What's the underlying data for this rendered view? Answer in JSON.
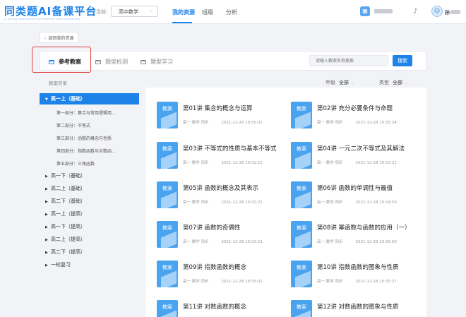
{
  "header": {
    "logo": "同类题AI备课平台",
    "logo_sub": "AI LESSON PREPARATION PLATFORM FOR SIMILAR PROBLEMS",
    "grade_label": "当前:",
    "grade_value": "高中数学",
    "nav": [
      "我的资源",
      "班级",
      "分析"
    ],
    "user_name": "孙"
  },
  "back_label": "返回我的资源",
  "tabs": [
    "参考教案",
    "题型检测",
    "题型学习"
  ],
  "search": {
    "placeholder": "请输入教案名称搜索",
    "button": "搜索"
  },
  "sidebar": {
    "title": "教案目录",
    "groups": [
      {
        "label": "高一上（基础）",
        "expanded": true,
        "children": [
          "第一部分：集合与常用逻辑用...",
          "第二部分：不等式",
          "第三部分：函数的概念与性质",
          "第四部分：指数函数与对数函...",
          "第五部分：三角函数"
        ]
      },
      {
        "label": "高一下（基础）"
      },
      {
        "label": "高二上（基础）"
      },
      {
        "label": "高二下（基础）"
      },
      {
        "label": "高一上（提高）"
      },
      {
        "label": "高一下（提高）"
      },
      {
        "label": "高二上（提高）"
      },
      {
        "label": "高二下（提高）"
      },
      {
        "label": "一轮复习"
      }
    ]
  },
  "filters": {
    "grade": {
      "label": "年级",
      "value": "全部"
    },
    "type": {
      "label": "类型",
      "value": "全部"
    }
  },
  "card_common": {
    "thumb_label": "教案",
    "meta": "高一 数学 同步"
  },
  "cards": [
    {
      "title": "第01讲 集合的概念与运算",
      "date": "2021-12-28 10:05:01"
    },
    {
      "title": "第02讲 充分必要条件与命题",
      "date": "2021-12-28 10:05:24"
    },
    {
      "title": "第03讲 不等式的性质与基本不等式",
      "date": "2021-12-28 10:02:21"
    },
    {
      "title": "第04讲 一元二次不等式及其解法",
      "date": "2021-12-28 10:02:21"
    },
    {
      "title": "第05讲 函数的概念及其表示",
      "date": "2021-12-28 10:02:21"
    },
    {
      "title": "第06讲 函数的单调性与最值",
      "date": "2021-12-28 10:04:59"
    },
    {
      "title": "第07讲 函数的奇偶性",
      "date": "2021-12-28 10:02:21"
    },
    {
      "title": "第08讲 幂函数与函数的应用（一）",
      "date": "2021-12-28 10:05:00"
    },
    {
      "title": "第09讲 指数函数的概念",
      "date": "2021-12-28 10:05:01"
    },
    {
      "title": "第10讲 指数函数的图象与性质",
      "date": "2021-12-28 10:05:27"
    },
    {
      "title": "第11讲 对数函数的概念",
      "date": ""
    },
    {
      "title": "第12讲 对数函数的图象与性质",
      "date": ""
    }
  ],
  "colors": {
    "accent": "#1e83e8",
    "highlight_box": "#e23b3b",
    "thumb": "#4aa3ef"
  }
}
